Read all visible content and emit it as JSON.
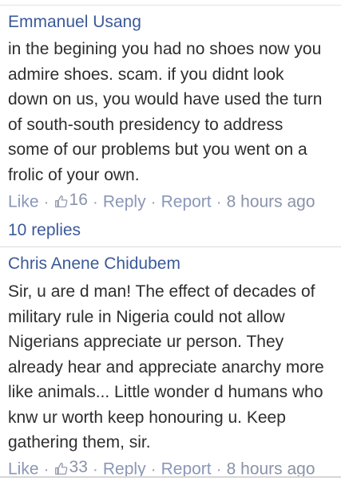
{
  "comments": [
    {
      "author": "Emmanuel Usang",
      "text": "in the begining you had no shoes now you\nadmire shoes. scam. if you didnt look\ndown on us, you would have used the turn\nof south-south presidency to address\nsome of our problems but you went on a\nfrolic of your own.",
      "like_label": "Like",
      "like_count": "16",
      "reply_label": "Reply",
      "report_label": "Report",
      "timestamp": "8 hours ago",
      "replies_label": "10 replies",
      "like_icon": "thumbs-up-icon"
    },
    {
      "author": "Chris Anene Chidubem",
      "text": "Sir, u are d man! The effect of decades of\nmilitary rule in Nigeria could not allow\nNigerians appreciate ur person. They\nalready hear and appreciate anarchy more\nlike animals... Little wonder d humans who\nknw ur worth keep honouring u. Keep\ngathering them, sir.",
      "like_label": "Like",
      "like_count": "33",
      "reply_label": "Reply",
      "report_label": "Report",
      "timestamp": "8 hours ago",
      "like_icon": "thumbs-up-icon"
    }
  ],
  "separator": "·",
  "colors": {
    "author": "#3b5a9a",
    "body": "#2e2e2e",
    "meta": "#8a93a8"
  }
}
